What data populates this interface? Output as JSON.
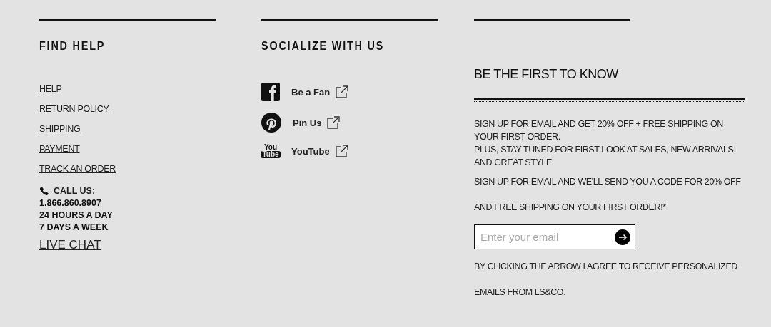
{
  "find_help": {
    "heading": "FIND HELP",
    "links": [
      "HELP",
      "RETURN POLICY",
      "SHIPPING",
      "PAYMENT",
      "TRACK AN ORDER"
    ],
    "call_label": "CALL US:",
    "phone": "1.866.860.8907",
    "hours": "24 HOURS A DAY",
    "days": "7 DAYS A WEEK",
    "live_chat": "LIVE CHAT"
  },
  "socialize": {
    "heading": "SOCIALIZE WITH US",
    "items": [
      {
        "kind": "facebook",
        "label": "Be a Fan"
      },
      {
        "kind": "pinterest",
        "label": "Pin Us"
      },
      {
        "kind": "youtube",
        "label": "YouTube",
        "icon_text": [
          "You",
          "Tube"
        ]
      }
    ]
  },
  "newsletter": {
    "heading": "BE THE FIRST TO KNOW",
    "intro": [
      "SIGN UP FOR EMAIL AND GET 20% OFF + FREE SHIPPING ON YOUR FIRST ORDER.",
      "PLUS, STAY TUNED FOR FIRST LOOK AT SALES, NEW ARRIVALS, AND GREAT STYLE!"
    ],
    "offer": "SIGN UP FOR EMAIL AND WE'LL SEND YOU A CODE FOR 20% OFF AND FREE SHIPPING ON YOUR FIRST ORDER!*",
    "email": {
      "placeholder": "Enter your email"
    },
    "consent": "BY CLICKING THE ARROW I AGREE TO RECEIVE PERSONALIZED EMAILS FROM LS&CO."
  }
}
